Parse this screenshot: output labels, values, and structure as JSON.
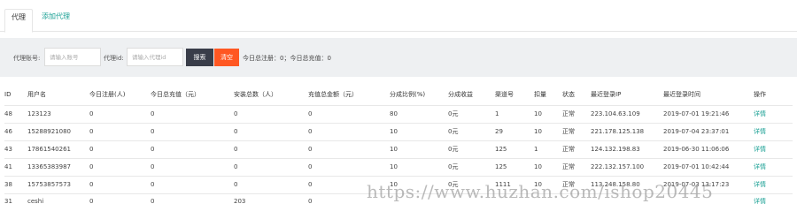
{
  "tabs": [
    {
      "label": "代理",
      "active": true
    },
    {
      "label": "添加代理",
      "active": false
    }
  ],
  "filter": {
    "account_label": "代理账号:",
    "account_placeholder": "请输入账号",
    "id_label": "代理id:",
    "id_placeholder": "请输入代理id",
    "search_button": "搜索",
    "clear_button": "清空",
    "stats_text": "今日总注册：0；今日总充值：0"
  },
  "table": {
    "columns": [
      "ID",
      "用户名",
      "今日注册(人)",
      "今日总充值（元）",
      "安装总数（人）",
      "充值总金额（元）",
      "分成比例(%)",
      "分成收益",
      "渠道号",
      "扣量",
      "状态",
      "最近登录IP",
      "最近登录时间",
      "操作"
    ],
    "rows": [
      [
        "48",
        "123123",
        "0",
        "0",
        "0",
        "0",
        "80",
        "0元",
        "1",
        "10",
        "正常",
        "223.104.63.109",
        "2019-07-01 19:21:46",
        "详情"
      ],
      [
        "46",
        "15288921080",
        "0",
        "0",
        "0",
        "0",
        "10",
        "0元",
        "29",
        "10",
        "正常",
        "221.178.125.138",
        "2019-07-04 23:37:01",
        "详情"
      ],
      [
        "43",
        "17861540261",
        "0",
        "0",
        "0",
        "0",
        "10",
        "0元",
        "125",
        "1",
        "正常",
        "124.132.198.83",
        "2019-06-30 11:06:06",
        "详情"
      ],
      [
        "41",
        "13365383987",
        "0",
        "0",
        "0",
        "0",
        "10",
        "0元",
        "125",
        "10",
        "正常",
        "222.132.157.100",
        "2019-07-01 10:42:44",
        "详情"
      ],
      [
        "38",
        "15753857573",
        "0",
        "0",
        "0",
        "0",
        "10",
        "0元",
        "1111",
        "10",
        "正常",
        "113.248.158.80",
        "2019-07-03 13:17:23",
        "详情"
      ],
      [
        "31",
        "ceshi",
        "0",
        "0",
        "203",
        "0",
        "",
        "",
        "",
        "",
        "",
        "",
        "",
        "详情"
      ]
    ]
  },
  "watermark": "https://www.huzhan.com/ishop20445",
  "colors": {
    "accent_green": "#1aa094",
    "search_button": "#393d49",
    "clear_button": "#ff5722",
    "filter_bg": "#eef0f2"
  }
}
